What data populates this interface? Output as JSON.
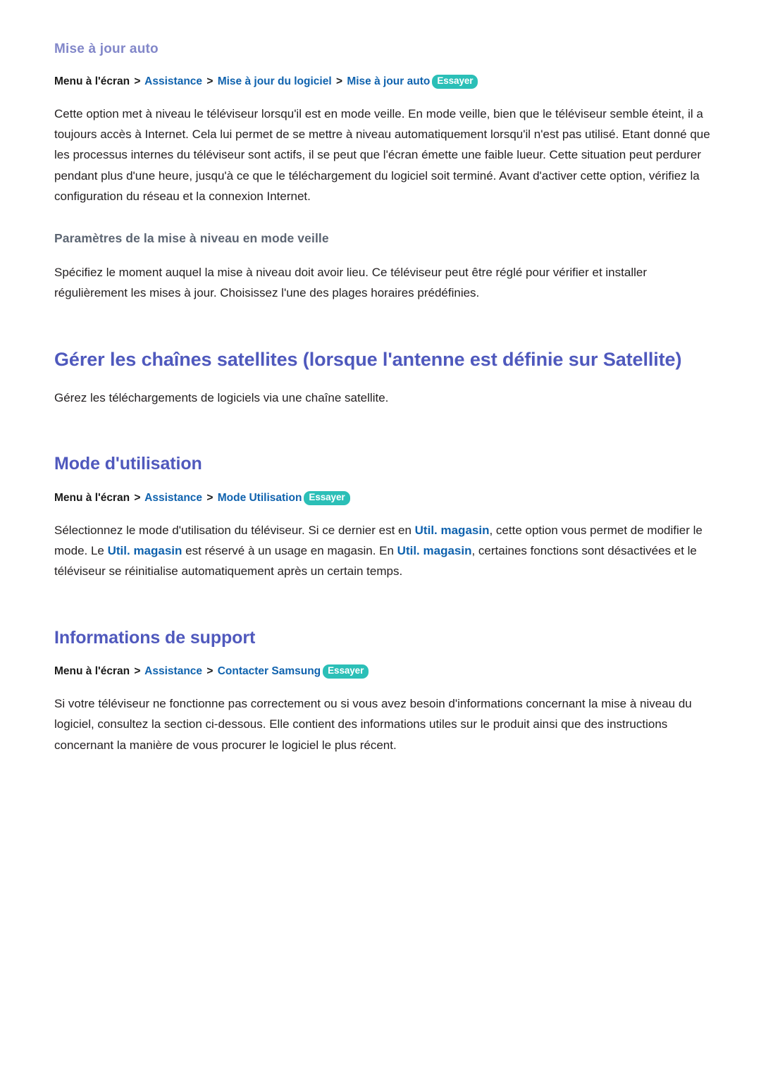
{
  "theme": {
    "accent_purple": "#8287c9",
    "accent_blue_heading": "#4f59bd",
    "link_blue": "#0f62ae",
    "badge_teal": "#2bbfb7",
    "subheading_slate": "#5c6572",
    "body_text": "#231f20",
    "page_bg": "#ffffff"
  },
  "labels": {
    "try_badge": "Essayer",
    "breadcrumb_separator": ">",
    "breadcrumb_root": "Menu à l'écran"
  },
  "sections": [
    {
      "id": "mise-a-jour-auto",
      "heading": "Mise à jour auto",
      "heading_level": "h3",
      "breadcrumb": {
        "root": "Menu à l'écran",
        "crumbs": [
          "Assistance",
          "Mise à jour du logiciel",
          "Mise à jour auto"
        ],
        "badge": "Essayer"
      },
      "paragraph": "Cette option met à niveau le téléviseur lorsqu'il est en mode veille. En mode veille, bien que le téléviseur semble éteint, il a toujours accès à Internet. Cela lui permet de se mettre à niveau automatiquement lorsqu'il n'est pas utilisé. Etant donné que les processus internes du téléviseur sont actifs, il se peut que l'écran émette une faible lueur. Cette situation peut perdurer pendant plus d'une heure, jusqu'à ce que le téléchargement du logiciel soit terminé. Avant d'activer cette option, vérifiez la configuration du réseau et la connexion Internet.",
      "subsection": {
        "heading": "Paramètres de la mise à niveau en mode veille",
        "paragraph": "Spécifiez le moment auquel la mise à niveau doit avoir lieu. Ce téléviseur peut être réglé pour vérifier et installer régulièrement les mises à jour. Choisissez l'une des plages horaires prédéfinies."
      }
    },
    {
      "id": "gerer-chaines-satellites",
      "heading": "Gérer les chaînes satellites (lorsque l'antenne est définie sur Satellite)",
      "heading_level": "h1",
      "paragraph": "Gérez les téléchargements de logiciels via une chaîne satellite."
    },
    {
      "id": "mode-utilisation",
      "heading": "Mode d'utilisation",
      "heading_level": "h2",
      "breadcrumb": {
        "root": "Menu à l'écran",
        "crumbs": [
          "Assistance",
          "Mode Utilisation"
        ],
        "badge": "Essayer"
      },
      "paragraph_parts": [
        {
          "type": "text",
          "value": "Sélectionnez le mode d'utilisation du téléviseur. Si ce dernier est en "
        },
        {
          "type": "keyword",
          "value": "Util. magasin"
        },
        {
          "type": "text",
          "value": ", cette option vous permet de modifier le mode. Le "
        },
        {
          "type": "keyword",
          "value": "Util. magasin"
        },
        {
          "type": "text",
          "value": " est réservé à un usage en magasin. En "
        },
        {
          "type": "keyword",
          "value": "Util. magasin"
        },
        {
          "type": "text",
          "value": ", certaines fonctions sont désactivées et le téléviseur se réinitialise automatiquement après un certain temps."
        }
      ],
      "paragraph_plain": "Sélectionnez le mode d'utilisation du téléviseur. Si ce dernier est en Util. magasin, cette option vous permet de modifier le mode. Le Util. magasin est réservé à un usage en magasin. En Util. magasin, certaines fonctions sont désactivées et le téléviseur se réinitialise automatiquement après un certain temps."
    },
    {
      "id": "informations-de-support",
      "heading": "Informations de support",
      "heading_level": "h2",
      "breadcrumb": {
        "root": "Menu à l'écran",
        "crumbs": [
          "Assistance",
          "Contacter Samsung"
        ],
        "badge": "Essayer"
      },
      "paragraph": "Si votre téléviseur ne fonctionne pas correctement ou si vous avez besoin d'informations concernant la mise à niveau du logiciel, consultez la section ci-dessous. Elle contient des informations utiles sur le produit ainsi que des instructions concernant la manière de vous procurer le logiciel le plus récent."
    }
  ]
}
